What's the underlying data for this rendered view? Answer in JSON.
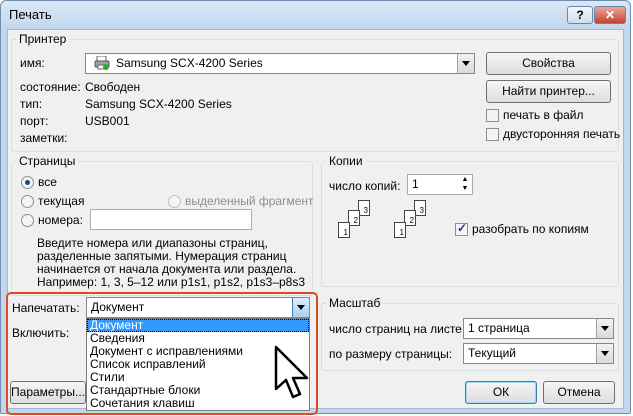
{
  "window": {
    "title": "Печать",
    "help_glyph": "?",
    "close_glyph": "✕"
  },
  "printer": {
    "group_label": "Принтер",
    "name_label": "имя:",
    "name_value": "Samsung SCX-4200 Series",
    "status_label": "состояние:",
    "status_value": "Свободен",
    "type_label": "тип:",
    "type_value": "Samsung SCX-4200 Series",
    "port_label": "порт:",
    "port_value": "USB001",
    "notes_label": "заметки:",
    "properties_button": "Свойства",
    "find_printer_button": "Найти принтер...",
    "print_to_file_label": "печать в файл",
    "print_to_file_checked": false,
    "duplex_label": "двусторонняя печать",
    "duplex_checked": false
  },
  "pages": {
    "group_label": "Страницы",
    "all_label": "все",
    "current_label": "текущая",
    "selection_label": "выделенный фрагмент",
    "numbers_label": "номера:",
    "numbers_value": "",
    "hint_line1": "Введите номера или диапазоны страниц,",
    "hint_line2": "разделенные запятыми. Нумерация страниц",
    "hint_line3": "начинается от начала документа или раздела.",
    "hint_line4": "Например: 1, 3, 5–12 или p1s1, p1s2, p1s3–p8s3",
    "selected": "все"
  },
  "copies": {
    "group_label": "Копии",
    "count_label": "число копий:",
    "count_value": "1",
    "collate_label": "разобрать по копиям",
    "collate_checked": true,
    "stack_a": [
      "1",
      "2",
      "3"
    ],
    "stack_b": [
      "1",
      "2",
      "3"
    ]
  },
  "print_what": {
    "label": "Напечатать:",
    "value": "Документ",
    "include_label": "Включить:",
    "options": [
      "Документ",
      "Сведения",
      "Документ с исправлениями",
      "Список исправлений",
      "Стили",
      "Стандартные блоки",
      "Сочетания клавиш"
    ],
    "highlight_color": "#e04a20"
  },
  "zoom": {
    "group_label": "Масштаб",
    "pages_per_sheet_label": "число страниц на листе:",
    "pages_per_sheet_value": "1 страница",
    "scale_label": "по размеру страницы:",
    "scale_value": "Текущий"
  },
  "buttons": {
    "options": "Параметры...",
    "ok": "ОК",
    "cancel": "Отмена"
  }
}
